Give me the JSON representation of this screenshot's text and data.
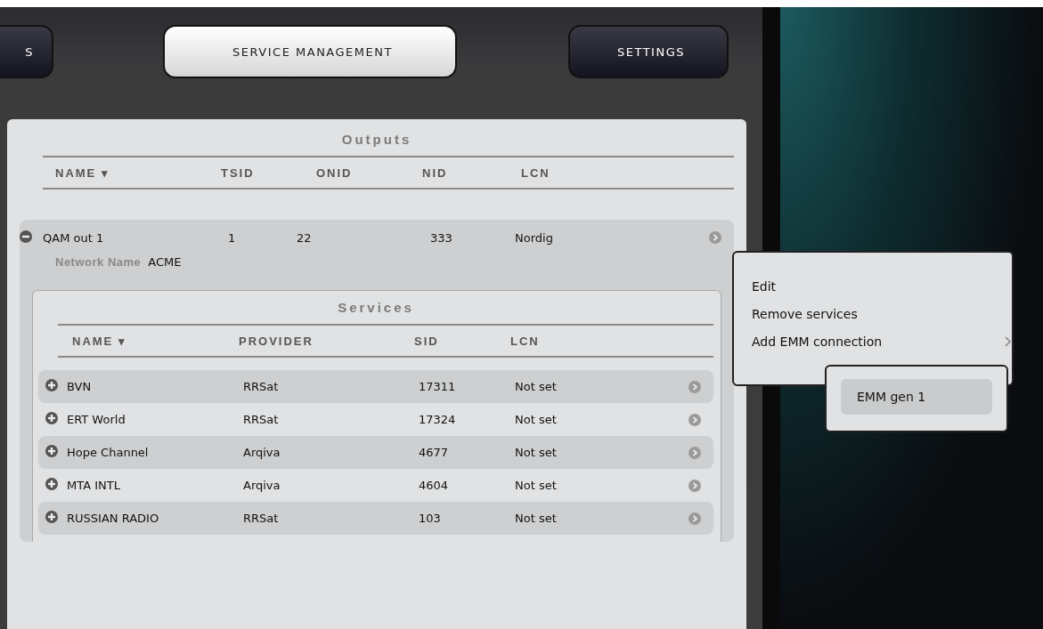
{
  "tabs": [
    {
      "label": "S",
      "selected": false
    },
    {
      "label": "SERVICE MANAGEMENT",
      "selected": true
    },
    {
      "label": "SETTINGS",
      "selected": false
    }
  ],
  "outputs": {
    "title": "Outputs",
    "columns": [
      "NAME ▾",
      "TSID",
      "ONID",
      "NID",
      "LCN"
    ],
    "rows": [
      {
        "expanded": true,
        "cells": [
          "QAM out 1",
          "1",
          "22",
          "333",
          "Nordig"
        ],
        "network_name_label": "Network Name",
        "network_name": "ACME",
        "services": {
          "title": "Services",
          "columns": [
            "NAME ▾",
            "PROVIDER",
            "SID",
            "LCN"
          ],
          "rows": [
            {
              "expanded": false,
              "cells": [
                "BVN",
                "RRSat",
                "17311",
                "Not set"
              ]
            },
            {
              "expanded": false,
              "cells": [
                "ERT World",
                "RRSat",
                "17324",
                "Not set"
              ]
            },
            {
              "expanded": false,
              "cells": [
                "Hope Channel",
                "Arqiva",
                "4677",
                "Not set"
              ]
            },
            {
              "expanded": false,
              "cells": [
                "MTA INTL",
                "Arqiva",
                "4604",
                "Not set"
              ]
            },
            {
              "expanded": false,
              "cells": [
                "RUSSIAN RADIO",
                "RRSat",
                "103",
                "Not set"
              ]
            }
          ]
        }
      }
    ]
  },
  "context_menu": {
    "items": [
      {
        "kind": "action",
        "label": "Edit"
      },
      {
        "kind": "action",
        "label": "Remove services"
      },
      {
        "kind": "submenu",
        "label": "Add EMM connection"
      }
    ],
    "submenu": {
      "items": [
        {
          "label": "EMM gen 1",
          "selected": true
        }
      ]
    }
  }
}
